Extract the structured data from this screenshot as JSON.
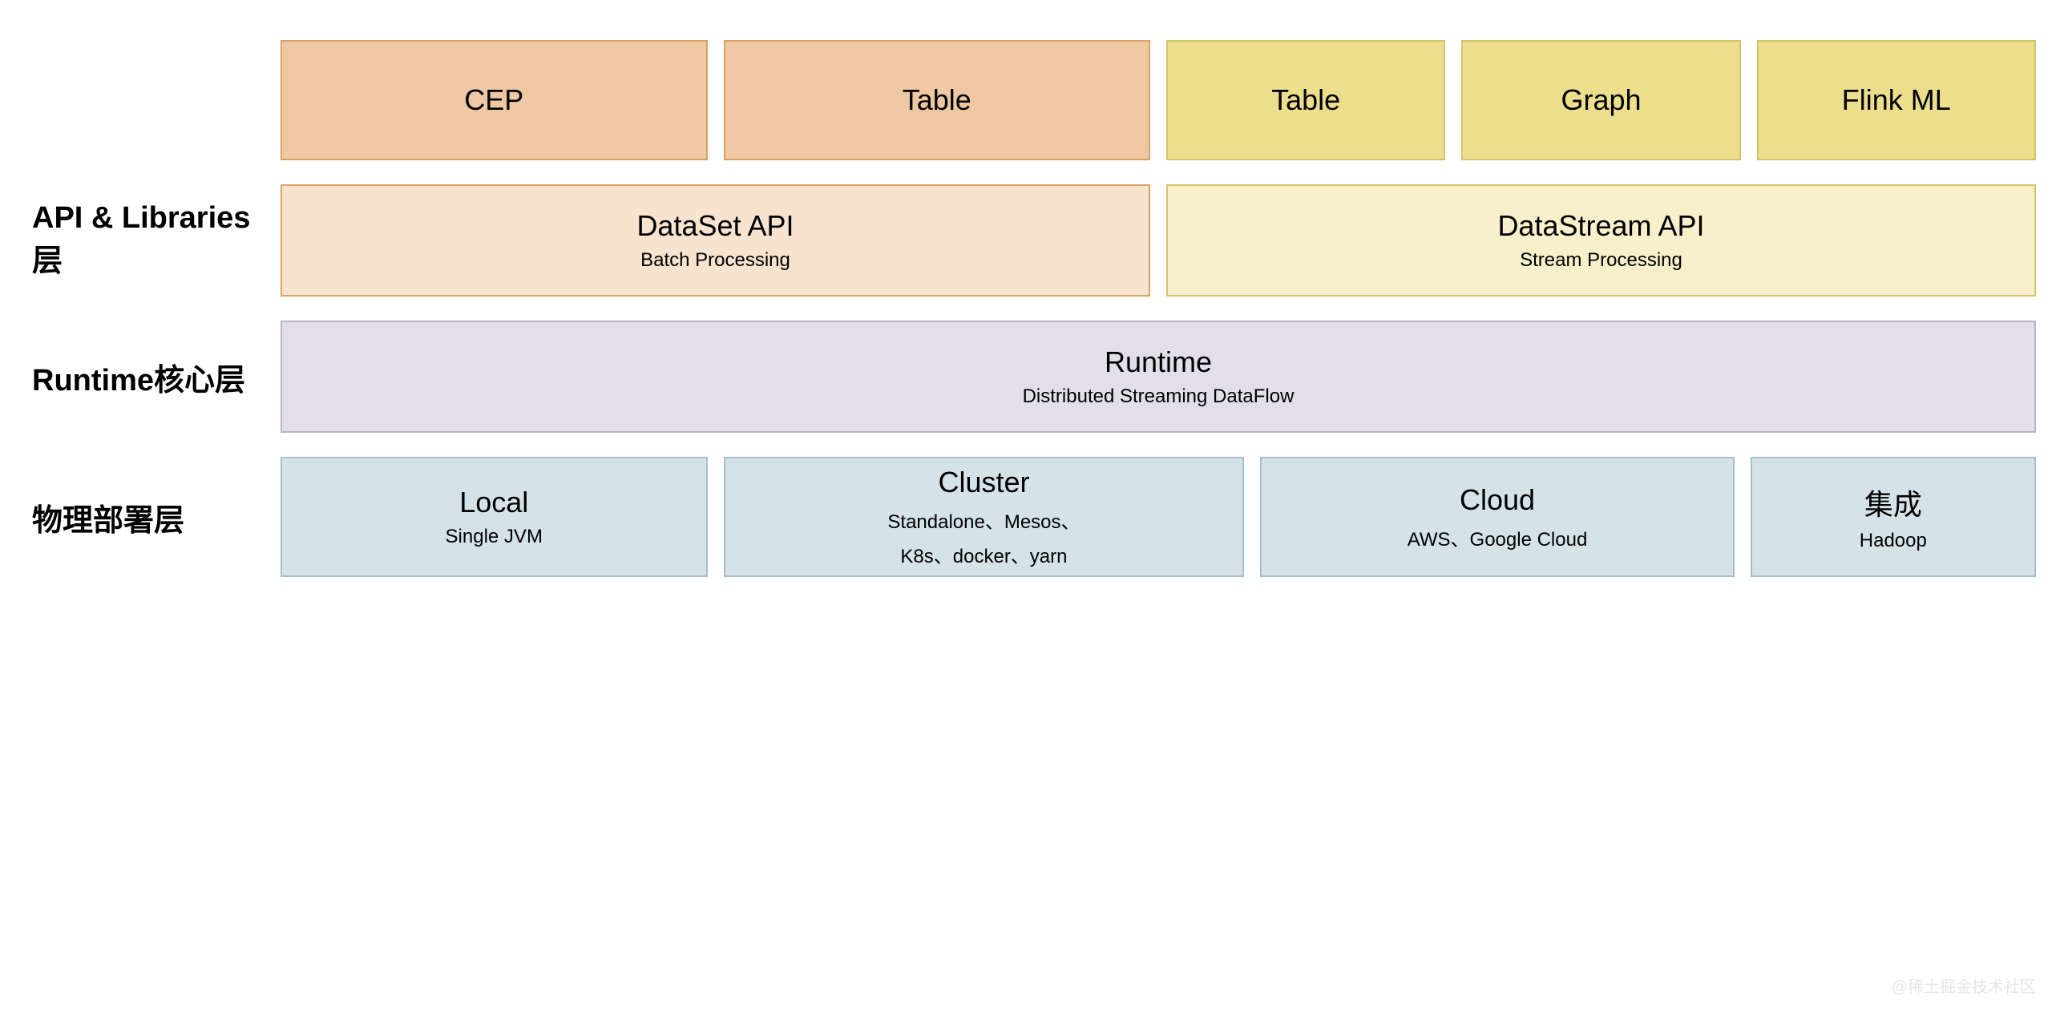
{
  "layers": {
    "api_libraries": {
      "label": "API & Libraries层",
      "libs_left": [
        {
          "name": "CEP"
        },
        {
          "name": "Table"
        }
      ],
      "libs_right": [
        {
          "name": "Table"
        },
        {
          "name": "Graph"
        },
        {
          "name": "Flink ML"
        }
      ],
      "apis": {
        "dataset": {
          "title": "DataSet API",
          "subtitle": "Batch Processing"
        },
        "datastream": {
          "title": "DataStream API",
          "subtitle": "Stream Processing"
        }
      }
    },
    "runtime": {
      "label": "Runtime核心层",
      "box": {
        "title": "Runtime",
        "subtitle": "Distributed Streaming DataFlow"
      }
    },
    "deploy": {
      "label": "物理部署层",
      "boxes": {
        "local": {
          "title": "Local",
          "subtitle": "Single JVM"
        },
        "cluster": {
          "title": "Cluster",
          "subtitle1": "Standalone、Mesos、",
          "subtitle2": "K8s、docker、yarn"
        },
        "cloud": {
          "title": "Cloud",
          "subtitle": "AWS、Google Cloud"
        },
        "integration": {
          "title": "集成",
          "subtitle": "Hadoop"
        }
      }
    }
  },
  "watermark": "@稀土掘金技术社区"
}
